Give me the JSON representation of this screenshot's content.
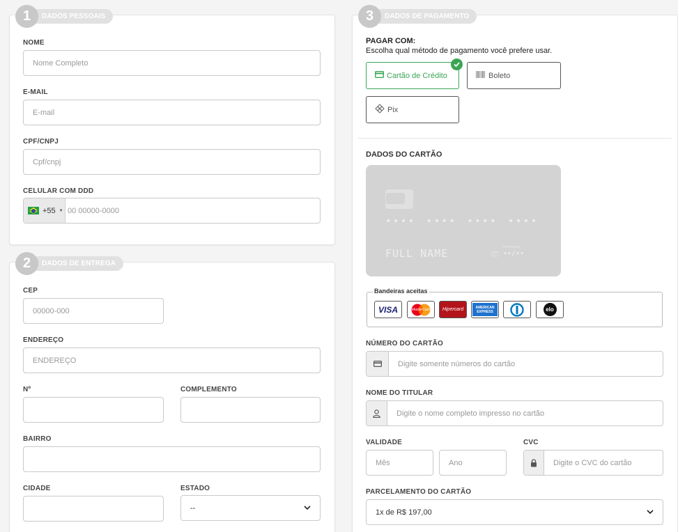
{
  "personal": {
    "step_number": "1",
    "step_label": "DADOS PESSOAIS",
    "name_label": "NOME",
    "name_placeholder": "Nome Completo",
    "email_label": "E-MAIL",
    "email_placeholder": "E-mail",
    "doc_label": "CPF/CNPJ",
    "doc_placeholder": "Cpf/cnpj",
    "phone_label": "CELULAR COM DDD",
    "phone_code": "+55",
    "phone_placeholder": "00 00000-0000"
  },
  "delivery": {
    "step_number": "2",
    "step_label": "DADOS DE ENTREGA",
    "cep_label": "CEP",
    "cep_placeholder": "00000-000",
    "address_label": "ENDEREÇO",
    "address_placeholder": "ENDEREÇO",
    "number_label": "Nº",
    "complement_label": "COMPLEMENTO",
    "district_label": "BAIRRO",
    "city_label": "CIDADE",
    "state_label": "ESTADO",
    "state_value": "--"
  },
  "payment": {
    "step_number": "3",
    "step_label": "DADOS DE PAGAMENTO",
    "pay_with_title": "PAGAR COM:",
    "pay_with_subtitle": "Escolha qual método de pagamento você prefere usar.",
    "options": [
      {
        "label": "Cartão de Crédito",
        "icon": "credit-card-icon",
        "selected": true
      },
      {
        "label": "Boleto",
        "icon": "barcode-icon",
        "selected": false
      },
      {
        "label": "Pix",
        "icon": "pix-icon",
        "selected": false
      }
    ],
    "card_section_title": "DADOS DO CARTÃO",
    "card_preview": {
      "number_mask": "•••• •••• •••• ••••",
      "name": "FULL NAME",
      "expiry_mask": "••/••",
      "expiry_caption": "month/year",
      "valid_caption": "valid thru"
    },
    "brands_legend": "Bandeiras aceitas",
    "brands": [
      "VISA",
      "MasterCard",
      "Hipercard",
      "AMERICAN EXPRESS",
      "Diners",
      "elo"
    ],
    "card_number_label": "NÚMERO DO CARTÃO",
    "card_number_placeholder": "Digite somente números do cartão",
    "holder_label": "NOME DO TITULAR",
    "holder_placeholder": "Digite o nome completo impresso no cartão",
    "validity_label": "VALIDADE",
    "month_placeholder": "Mês",
    "year_placeholder": "Ano",
    "cvc_label": "CVC",
    "cvc_placeholder": "Digite o CVC do cartão",
    "installments_label": "PARCELAMENTO DO CARTÃO",
    "installments_value": "1x de R$ 197,00"
  },
  "colors": {
    "accent_green": "#3aa655",
    "step_gray": "#c8c8c8"
  }
}
